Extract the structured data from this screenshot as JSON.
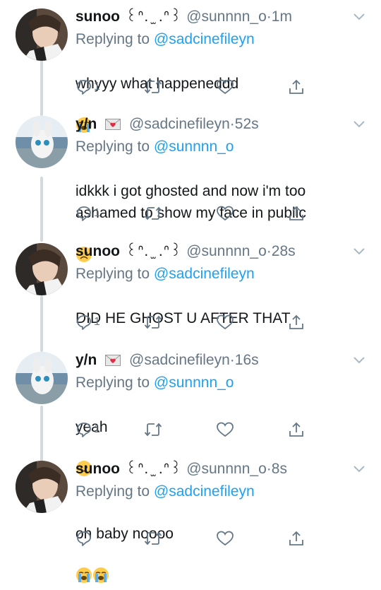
{
  "tweets": [
    {
      "author": "sunoo",
      "decoration": "꒰ᐢ. ̫ .ᐢ꒱",
      "handle": "@sunnnn_o",
      "time_sep": "·",
      "time": "1m",
      "replying_prefix": "Replying to",
      "replying_to": "@sadcinefileyn",
      "text": "whyyy what happeneddd",
      "emoji": [
        "loudly-crying-face"
      ],
      "reply_count": "1"
    },
    {
      "author": "y/n",
      "decoration": "",
      "handle": "@sadcinefileyn",
      "time_sep": "·",
      "time": "52s",
      "replying_prefix": "Replying to",
      "replying_to": "@sunnnn_o",
      "text": "idkkk i got ghosted and now i'm too\nashamed to show my face in public",
      "emoji": [
        "frowning-face"
      ],
      "reply_count": "1"
    },
    {
      "author": "sunoo",
      "decoration": "꒰ᐢ. ̫ .ᐢ꒱",
      "handle": "@sunnnn_o",
      "time_sep": "·",
      "time": "28s",
      "replying_prefix": "Replying to",
      "replying_to": "@sadcinefileyn",
      "text": "DID HE GHOST U AFTER THAT",
      "emoji": [],
      "reply_count": "1"
    },
    {
      "author": "y/n",
      "decoration": "",
      "handle": "@sadcinefileyn",
      "time_sep": "·",
      "time": "16s",
      "replying_prefix": "Replying to",
      "replying_to": "@sunnnn_o",
      "text": "yeah",
      "emoji": [
        "frowning-face"
      ],
      "reply_count": "1"
    },
    {
      "author": "sunoo",
      "decoration": "꒰ᐢ. ̫ .ᐢ꒱",
      "handle": "@sunnnn_o",
      "time_sep": "·",
      "time": "8s",
      "replying_prefix": "Replying to",
      "replying_to": "@sadcinefileyn",
      "text": "oh baby noooo",
      "emoji": [
        "loudly-crying-face",
        "loudly-crying-face"
      ],
      "reply_count": ""
    }
  ],
  "colors": {
    "link": "#1da1f2",
    "secondary_text": "#657786",
    "thread_line": "#d4d9dd"
  }
}
